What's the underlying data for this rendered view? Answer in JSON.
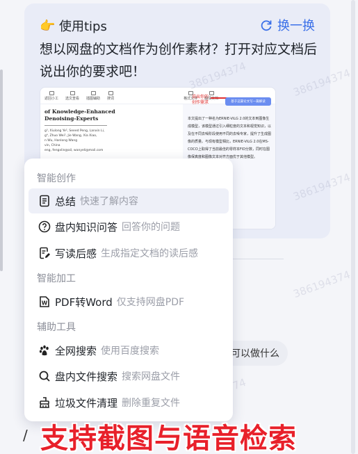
{
  "tips": {
    "title": "使用tips",
    "refresh_label": "换一换",
    "text": "想以网盘的文档作为创作素材？打开对应文档后说出你的要求吧！",
    "preview": {
      "toolbar": [
        "返回小工",
        "选文查看",
        "插图辅助",
        "搜词",
        "格式文件",
        "翻译文档"
      ],
      "doc_title_lines": [
        "of Knowledge-Enhanced",
        "Denoising-Experts"
      ],
      "doc_lines": [
        "g³, Xiulong Ye², Seeed Peng, Lanxin Li,",
        "g⁴, Zhuo Wei², Jie Wang, Xia Xiao,",
        "n Wu, Hanlong Wang",
        "vin, China",
        "eng, fengxlin@ail, wanyeli@mail.com"
      ],
      "callout": [
        "说出你的",
        "创作需求"
      ],
      "chip_label": "基于这篇论文写一篇解读",
      "para": "本文提出了一种名为ERNIE-ViLG 2.0的文本到图像生成模型，该模型通过引入细粒度的文本和视觉知识，以及在不同去噪阶段使用不同的去噪专家，提升了生成图像的质量。与现有模型相比，ERNIE-ViLG 2.0在MS-COCO上取得了当前最佳的零样本FID分数，同时在图像保真度和图像文本对齐方面优于其他模型。"
    }
  },
  "menu": {
    "sections": {
      "create": "智能创作",
      "process": "智能加工",
      "tools": "辅助工具"
    },
    "items": [
      {
        "label": "总结",
        "desc": "快速了解内容"
      },
      {
        "label": "盘内知识问答",
        "desc": "回答你的问题"
      },
      {
        "label": "写读后感",
        "desc": "生成指定文档的读后感"
      },
      {
        "label": "PDF转Word",
        "desc": "仅支持网盘PDF"
      },
      {
        "label": "全网搜索",
        "desc": "使用百度搜索"
      },
      {
        "label": "盘内文件搜索",
        "desc": "搜索网盘文件"
      },
      {
        "label": "垃圾文件清理",
        "desc": "删除重复文件"
      }
    ]
  },
  "suggestion_pill": "可以做什么",
  "input_slash": "/",
  "banner": "支持截图与语音检索",
  "watermark": "386194374",
  "colors": {
    "accent": "#3a6fe8",
    "banner": "#e8202a",
    "card_bg": "#e9ecf7"
  }
}
